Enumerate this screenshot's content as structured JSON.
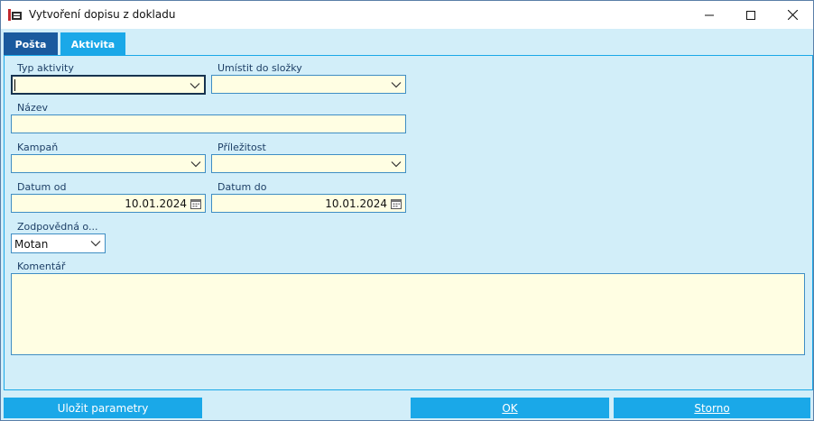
{
  "window": {
    "title": "Vytvoření dopisu z dokladu"
  },
  "tabs": [
    {
      "label": "Pošta",
      "active": false
    },
    {
      "label": "Aktivita",
      "active": true
    }
  ],
  "form": {
    "typ_aktivity": {
      "label": "Typ aktivity",
      "value": ""
    },
    "umistit": {
      "label": "Umístit do složky",
      "value": ""
    },
    "nazev": {
      "label": "Název",
      "value": ""
    },
    "kampan": {
      "label": "Kampaň",
      "value": ""
    },
    "prilezitost": {
      "label": "Příležitost",
      "value": ""
    },
    "datum_od": {
      "label": "Datum od",
      "value": "10.01.2024"
    },
    "datum_do": {
      "label": "Datum do",
      "value": "10.01.2024"
    },
    "zodpovedna": {
      "label": "Zodpovědná o...",
      "value": "Motan"
    },
    "komentar": {
      "label": "Komentář",
      "value": ""
    }
  },
  "footer": {
    "save_params": "Uložit parametry",
    "ok": "OK",
    "cancel": "Storno"
  },
  "colors": {
    "accent": "#1aa8e8",
    "tab_inactive": "#1a5a9e",
    "panel_bg": "#d2eef9",
    "field_bg": "#fffee3",
    "field_border": "#3f8ec4",
    "label_text": "#1d3f66"
  },
  "icons": [
    "app-icon",
    "minimize-icon",
    "maximize-icon",
    "close-icon",
    "chevron-down-icon",
    "calendar-icon"
  ]
}
